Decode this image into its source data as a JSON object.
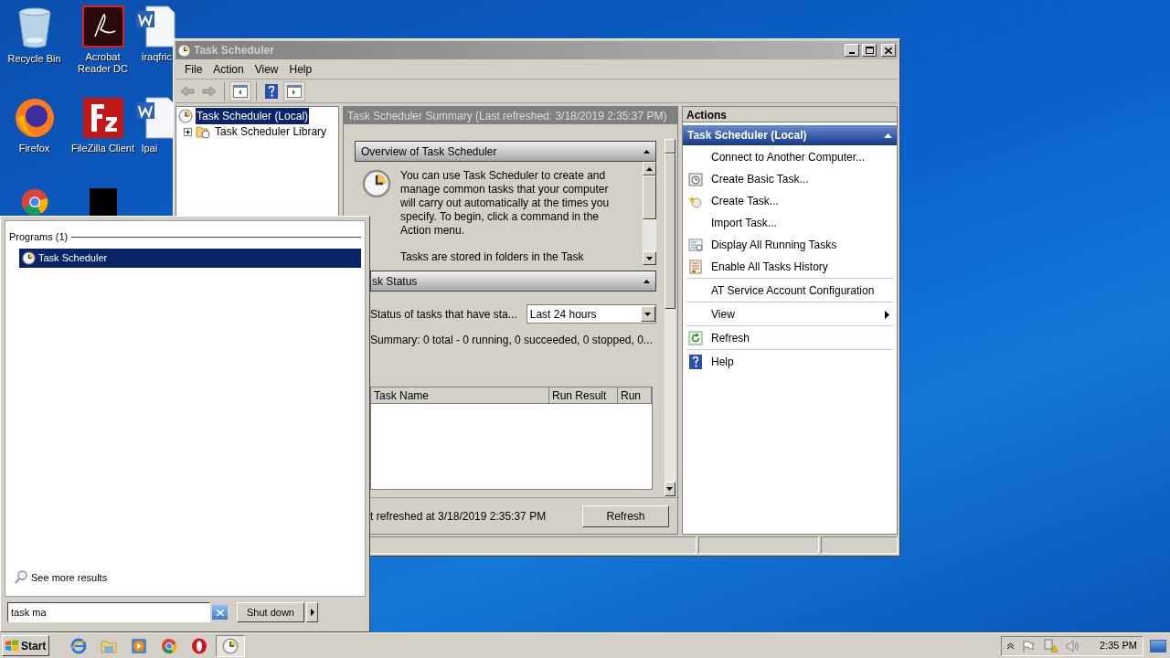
{
  "desktop_icons": [
    {
      "kind": "recycle-bin",
      "label": "Recycle Bin"
    },
    {
      "kind": "acrobat",
      "label": "Acrobat Reader DC"
    },
    {
      "kind": "word",
      "label": "iraqfric"
    },
    {
      "kind": "firefox",
      "label": "Firefox"
    },
    {
      "kind": "filezilla",
      "label": "FileZilla Client"
    },
    {
      "kind": "word",
      "label": "lpai"
    },
    {
      "kind": "chrome"
    },
    {
      "kind": "dark"
    }
  ],
  "window": {
    "title": "Task Scheduler",
    "menu": [
      "File",
      "Action",
      "View",
      "Help"
    ],
    "tree": [
      {
        "label": "Task Scheduler (Local)",
        "selected": true,
        "children": [
          {
            "label": "Task Scheduler Library",
            "selected": false,
            "expanded": false
          }
        ]
      }
    ],
    "summary": {
      "header": "Task Scheduler Summary (Last refreshed: 3/18/2019 2:35:37 PM)",
      "overview": {
        "title": "Overview of Task Scheduler",
        "expanded": true,
        "paragraphs": [
          "You can use Task Scheduler to create and manage common tasks that your computer will carry out automatically at the times you specify. To begin, click a command in the Action menu.",
          "Tasks are stored in folders in the Task"
        ]
      },
      "status": {
        "title": "sk Status",
        "expanded": true,
        "filter_label": "Status of tasks that have sta...",
        "filter_value": "Last 24 hours",
        "summary": "Summary: 0 total - 0 running, 0 succeeded, 0 stopped, 0...",
        "columns": [
          "Task Name",
          "Run Result",
          "Run"
        ]
      },
      "refreshed": "t refreshed at 3/18/2019 2:35:37 PM",
      "refresh_button": "Refresh"
    },
    "actions": {
      "title": "Actions",
      "group": {
        "label": "Task Scheduler (Local)",
        "expanded": true
      },
      "sections": [
        {
          "items": [
            {
              "label": "Connect to Another Computer...",
              "kind": "plain",
              "submenu": false
            },
            {
              "label": "Create Basic Task...",
              "kind": "basic-task",
              "submenu": false
            },
            {
              "label": "Create Task...",
              "kind": "create-task",
              "submenu": false
            },
            {
              "label": "Import Task...",
              "kind": "plain",
              "submenu": false
            },
            {
              "label": "Display All Running Tasks",
              "kind": "running",
              "submenu": false
            },
            {
              "label": "Enable All Tasks History",
              "kind": "history",
              "submenu": false
            }
          ]
        },
        {
          "items": [
            {
              "label": "AT Service Account Configuration",
              "kind": "plain",
              "submenu": false
            }
          ]
        },
        {
          "items": [
            {
              "label": "View",
              "kind": "plain",
              "submenu": true
            }
          ]
        },
        {
          "items": [
            {
              "label": "Refresh",
              "kind": "refresh",
              "submenu": false
            }
          ]
        },
        {
          "items": [
            {
              "label": "Help",
              "kind": "help",
              "submenu": false
            }
          ]
        }
      ]
    }
  },
  "start_menu": {
    "heading": "Programs (1)",
    "results": [
      {
        "label": "Task Scheduler",
        "selected": true
      }
    ],
    "see_more": "See more results",
    "search": {
      "value": "task ma"
    },
    "shutdown": "Shut down"
  },
  "taskbar": {
    "start": "Start",
    "apps": [
      {
        "kind": "ie",
        "selected": false
      },
      {
        "kind": "explorer",
        "selected": false
      },
      {
        "kind": "media",
        "selected": false
      },
      {
        "kind": "chrome",
        "selected": false
      },
      {
        "kind": "opera",
        "selected": false
      },
      {
        "kind": "clock",
        "selected": true
      }
    ],
    "clock": "2:35 PM"
  }
}
